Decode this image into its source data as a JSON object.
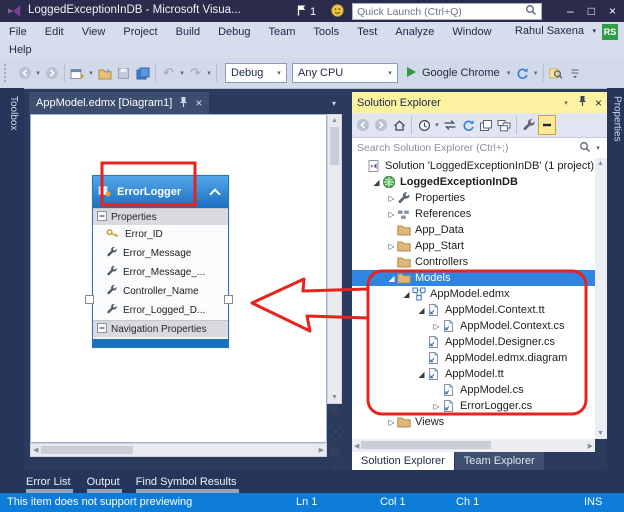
{
  "titlebar": {
    "title": "LoggedExceptionInDB - Microsoft Visua...",
    "notification_count": "1",
    "quick_launch_placeholder": "Quick Launch (Ctrl+Q)",
    "minimize": "–",
    "maximize": "□",
    "close": "×"
  },
  "menubar": {
    "items": [
      "File",
      "Edit",
      "View",
      "Project",
      "Build",
      "Debug",
      "Team",
      "Tools",
      "Test",
      "Analyze",
      "Window"
    ],
    "second_row": [
      "Help"
    ],
    "user_name": "Rahul Saxena",
    "avatar_initials": "RS"
  },
  "toolbar": {
    "debug_target": "Debug",
    "platform": "Any CPU",
    "run_browser": "Google Chrome"
  },
  "left_rail": {
    "tab": "Toolbox"
  },
  "right_rail": {
    "tab": "Properties"
  },
  "editor": {
    "tab_title": "AppModel.edmx [Diagram1]"
  },
  "entity": {
    "title": "ErrorLogger",
    "properties_header": "Properties",
    "navigation_header": "Navigation Properties",
    "properties": [
      {
        "name": "Error_ID",
        "icon": "key"
      },
      {
        "name": "Error_Message",
        "icon": "prop-wrench"
      },
      {
        "name": "Error_Message_...",
        "icon": "prop-wrench"
      },
      {
        "name": "Controller_Name",
        "icon": "prop-wrench"
      },
      {
        "name": "Error_Logged_D...",
        "icon": "prop-wrench"
      }
    ]
  },
  "solution_explorer": {
    "title": "Solution Explorer",
    "search_placeholder": "Search Solution Explorer (Ctrl+;)",
    "tree": [
      {
        "label": "Solution 'LoggedExceptionInDB' (1 project)",
        "level": 0,
        "icon": "solution",
        "expand": null
      },
      {
        "label": "LoggedExceptionInDB",
        "level": 1,
        "icon": "project",
        "expand": "expanded",
        "bold": true
      },
      {
        "label": "Properties",
        "level": 2,
        "icon": "wrench",
        "expand": "collapsed"
      },
      {
        "label": "References",
        "level": 2,
        "icon": "references",
        "expand": "collapsed"
      },
      {
        "label": "App_Data",
        "level": 2,
        "icon": "folder",
        "expand": null
      },
      {
        "label": "App_Start",
        "level": 2,
        "icon": "folder",
        "expand": "collapsed"
      },
      {
        "label": "Controllers",
        "level": 2,
        "icon": "folder",
        "expand": null
      },
      {
        "label": "Models",
        "level": 2,
        "icon": "folder",
        "expand": "expanded",
        "selected": true
      },
      {
        "label": "AppModel.edmx",
        "level": 3,
        "icon": "edmx",
        "expand": "expanded"
      },
      {
        "label": "AppModel.Context.tt",
        "level": 4,
        "icon": "tt-file",
        "expand": "expanded"
      },
      {
        "label": "AppModel.Context.cs",
        "level": 5,
        "icon": "tt-file",
        "expand": "collapsed"
      },
      {
        "label": "AppModel.Designer.cs",
        "level": 4,
        "icon": "tt-file",
        "expand": null
      },
      {
        "label": "AppModel.edmx.diagram",
        "level": 4,
        "icon": "tt-file",
        "expand": null
      },
      {
        "label": "AppModel.tt",
        "level": 4,
        "icon": "tt-file",
        "expand": "expanded"
      },
      {
        "label": "AppModel.cs",
        "level": 5,
        "icon": "tt-file",
        "expand": null
      },
      {
        "label": "ErrorLogger.cs",
        "level": 5,
        "icon": "tt-file",
        "expand": "collapsed"
      },
      {
        "label": "Views",
        "level": 2,
        "icon": "folder",
        "expand": "collapsed"
      }
    ],
    "bottom_tabs": [
      {
        "label": "Solution Explorer",
        "active": true
      },
      {
        "label": "Team Explorer",
        "active": false
      }
    ]
  },
  "bottom_panel": {
    "tabs": [
      "Error List",
      "Output",
      "Find Symbol Results"
    ]
  },
  "statusbar": {
    "message": "This item does not support previewing",
    "line": "Ln 1",
    "column": "Col 1",
    "char": "Ch 1",
    "mode": "INS"
  },
  "colors": {
    "accent_blue": "#0d7dd9",
    "annotation_red": "#e8231d",
    "selection_blue": "#2e86e0",
    "titlebar": "#2b2c4b",
    "active_panel_yellow": "#fdf2a0"
  }
}
